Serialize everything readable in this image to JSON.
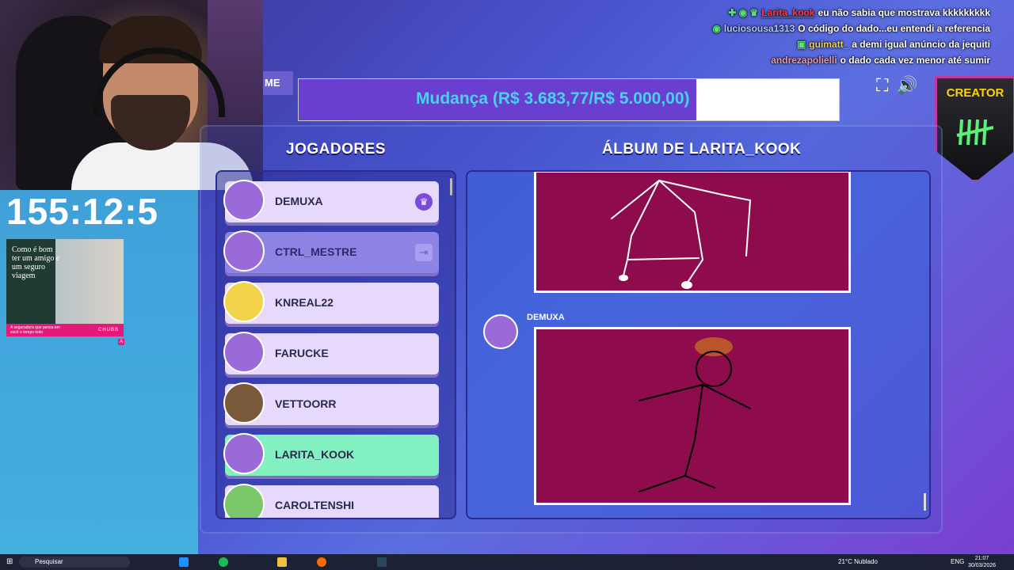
{
  "stream": {
    "timer": "155:12:5",
    "ad": {
      "headline": "Como é bom ter um amigo e um seguro viagem",
      "footer": "A seguradora que pensa em você o tempo todo",
      "brand": "CHUBB",
      "badge": "A"
    },
    "chat": [
      {
        "user": "Larita_kook",
        "message": "eu não sabia que mostrava kkkkkkkkk"
      },
      {
        "user": "luciosousa1313",
        "message": "O código do dado...eu entendi a referencia"
      },
      {
        "user": "guimatt_",
        "message": "a demi igual anúncio da jequiti"
      },
      {
        "user": "andrezapolielli",
        "message": "o dado cada vez menor até sumir"
      }
    ],
    "goal": {
      "label": "Mudança (R$ 3.683,77/R$ 5.000,00)",
      "progress_fraction": 0.7367
    },
    "creator_badge": "CREATOR"
  },
  "game": {
    "tab_label": "ME",
    "players_heading": "JOGADORES",
    "album_heading": "ÁLBUM DE LARITA_KOOK",
    "players": [
      {
        "name": "DEMUXA",
        "state": "normal",
        "icon": "crown-icon"
      },
      {
        "name": "CTRL_MESTRE",
        "state": "dim",
        "icon": "exit-icon"
      },
      {
        "name": "KNREAL22",
        "state": "normal"
      },
      {
        "name": "FARUCKE",
        "state": "normal"
      },
      {
        "name": "VETTOORR",
        "state": "normal"
      },
      {
        "name": "LARITA_KOOK",
        "state": "highlight"
      },
      {
        "name": "CAROLTENSHI",
        "state": "normal"
      }
    ],
    "album": {
      "entry_author": "DEMUXA"
    }
  },
  "taskbar": {
    "search_placeholder": "Pesquisar",
    "weather": "21°C Nublado",
    "language": "ENG",
    "time": "21:07",
    "date": "30/03/2026"
  },
  "colors": {
    "drawing_bg": "#8e0b4d",
    "highlight_player": "#83f0c1",
    "goal_fill": "#6a3fd0",
    "goal_text": "#4ad0f0"
  }
}
